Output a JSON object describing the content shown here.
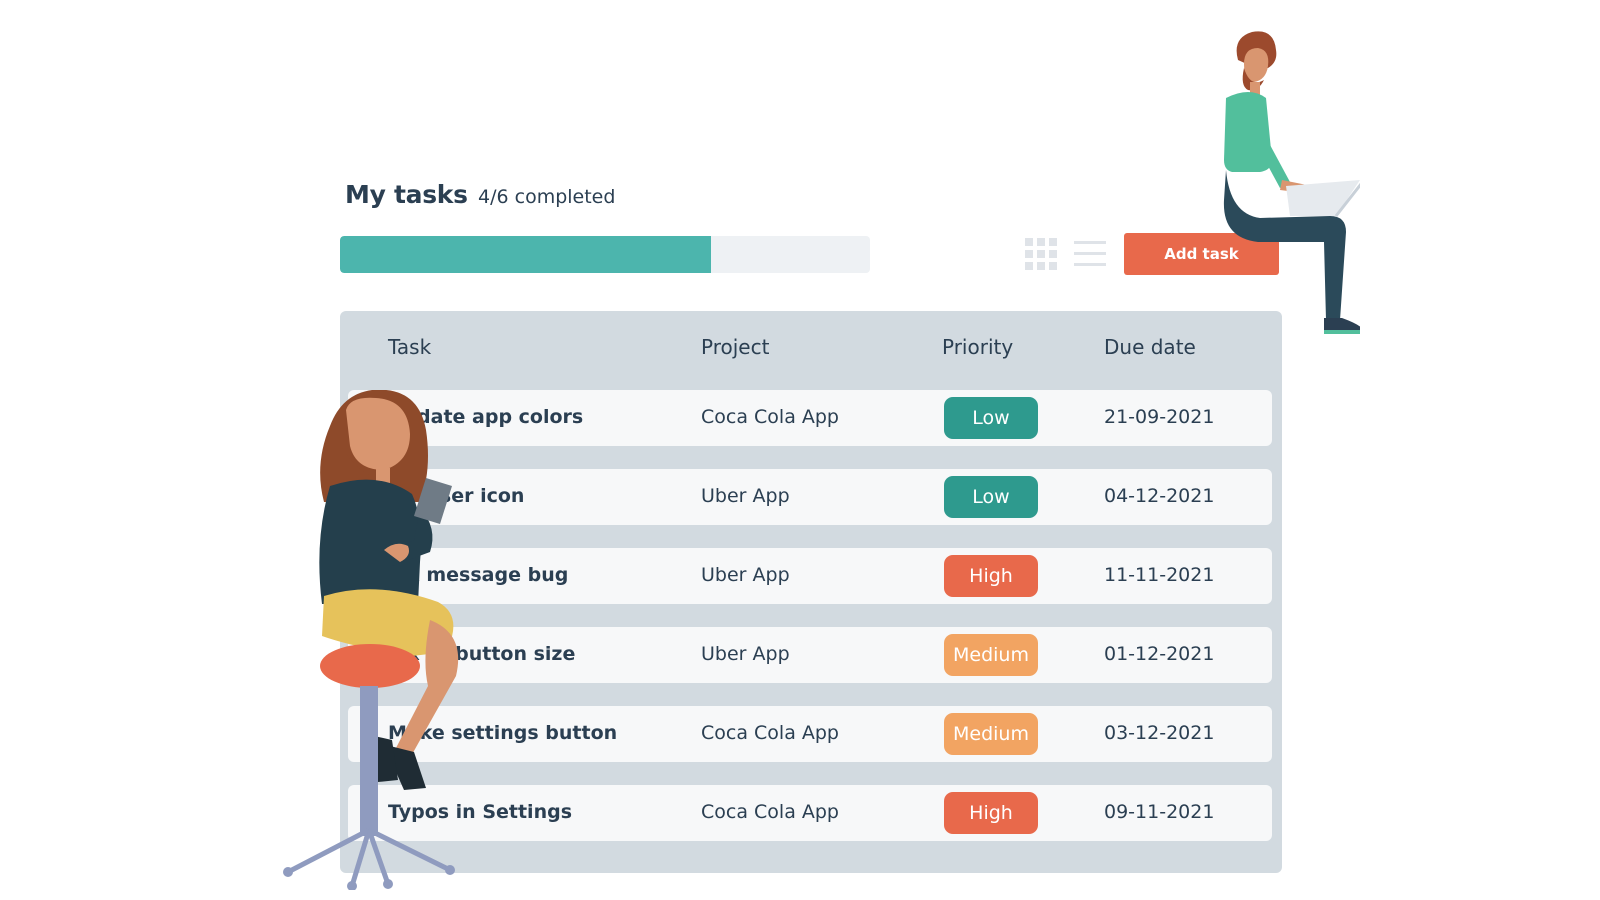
{
  "header": {
    "title": "My tasks",
    "completed_text": "4/6 completed",
    "progress_fraction": 0.7
  },
  "toolbar": {
    "grid_icon": "grid-view-icon",
    "list_icon": "list-view-icon",
    "add_label": "Add task"
  },
  "table": {
    "columns": [
      "Task",
      "Project",
      "Priority",
      "Due date"
    ],
    "rows": [
      {
        "task": "Update app colors",
        "project": "Coca Cola App",
        "priority": "Low",
        "due": "21-09-2021"
      },
      {
        "task": "Fix user icon",
        "project": "Uber App",
        "priority": "Low",
        "due": "04-12-2021"
      },
      {
        "task": "Fix message bug",
        "project": "Uber App",
        "priority": "High",
        "due": "11-11-2021"
      },
      {
        "task": "Fix to button size",
        "project": "Uber App",
        "priority": "Medium",
        "due": "01-12-2021"
      },
      {
        "task": "Make settings button",
        "project": "Coca Cola App",
        "priority": "Medium",
        "due": "03-12-2021"
      },
      {
        "task": "Typos in Settings",
        "project": "Coca Cola App",
        "priority": "High",
        "due": "09-11-2021"
      }
    ]
  },
  "colors": {
    "accent": "#4cb5ad",
    "add_button": "#e8694b",
    "priority_low": "#2e9a8e",
    "priority_medium": "#f2a462",
    "priority_high": "#e8694b"
  }
}
